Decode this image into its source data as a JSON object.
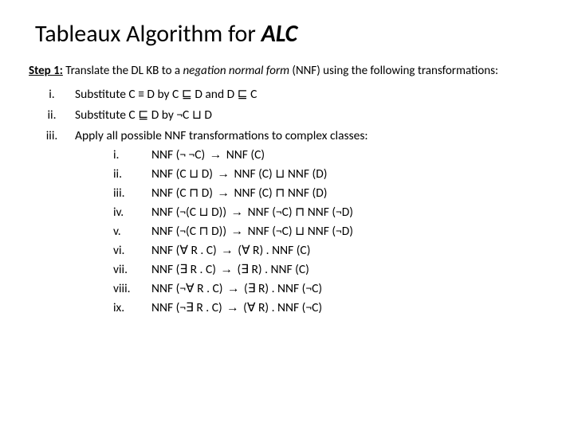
{
  "title_prefix": "Tableaux Algorithm for ",
  "title_suffix": "ALC",
  "step_label": "Step 1:",
  "step_text1": " Translate the DL KB to a ",
  "step_italic": "negation normal form",
  "step_text2": " (NNF) using the following transformations:",
  "outer": [
    {
      "num": "i.",
      "t1": "Substitute C ≡ D by C ",
      "sq": "⊑",
      "t2": " D and D ",
      "sq2": "⊑",
      "t3": " C"
    },
    {
      "num": "ii.",
      "t1": "Substitute C ",
      "sq": "⊑",
      "t2": " D by ¬C ⊔ D"
    },
    {
      "num": "iii.",
      "intro": "Apply all possible NNF transformations to complex classes:"
    }
  ],
  "inner": [
    {
      "num": "i.",
      "lhs": "NNF (¬ ¬C) ",
      "rhs": " NNF (C)"
    },
    {
      "num": "ii.",
      "lhs": "NNF (C ⊔ D) ",
      "rhs": " NNF (C) ⊔ NNF (D)"
    },
    {
      "num": "iii.",
      "lhs": "NNF (C ⊓ D) ",
      "rhs": " NNF (C) ⊓ NNF (D)"
    },
    {
      "num": "iv.",
      "lhs": "NNF (¬(C ⊔ D)) ",
      "rhs": " NNF (¬C) ⊓ NNF (¬D)"
    },
    {
      "num": "v.",
      "lhs": "NNF (¬(C ⊓ D)) ",
      "rhs": " NNF (¬C) ⊔ NNF (¬D)"
    },
    {
      "num": "vi.",
      "lhs": "NNF (∀ R . C) ",
      "rhs": " (∀ R) . NNF (C)"
    },
    {
      "num": "vii.",
      "lhs": "NNF (∃ R . C) ",
      "rhs": " (∃ R) . NNF (C)"
    },
    {
      "num": "viii.",
      "lhs": "NNF (¬∀ R . C) ",
      "rhs": " (∃ R) . NNF (¬C)"
    },
    {
      "num": "ix.",
      "lhs": "NNF (¬∃ R . C) ",
      "rhs": " (∀ R) . NNF (¬C)"
    }
  ],
  "arrow": "→"
}
